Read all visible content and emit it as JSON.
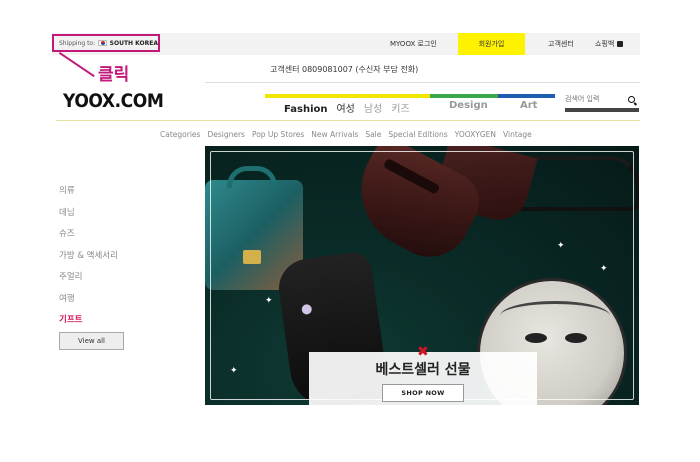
{
  "topbar": {
    "shipping_label": "Shipping to:",
    "country": "SOUTH KOREA",
    "links": {
      "login": "MYOOX 로그인",
      "join": "회원가입",
      "support": "고객센터",
      "cart": "쇼핑백"
    }
  },
  "annotation": {
    "text": "클릭",
    "color": "#c2187a"
  },
  "service_line": "고객센터 0809081007 (수신자 부담 전화)",
  "logo": "YOOX.COM",
  "main_nav": {
    "fashion": "Fashion",
    "women": "여성",
    "men": "남성",
    "kids": "키즈",
    "design": "Design",
    "art": "Art"
  },
  "nav_colors": {
    "fashion": "#f2e600",
    "design": "#3aa84a",
    "art": "#1f5db0"
  },
  "search": {
    "placeholder": "검색어 입력"
  },
  "sub_nav": [
    "Categories",
    "Designers",
    "Pop Up Stores",
    "New Arrivals",
    "Sale",
    "Special Editions",
    "YOOXYGEN",
    "Vintage"
  ],
  "sidebar": {
    "items": [
      "의류",
      "데님",
      "슈즈",
      "가방 & 액세서리",
      "주얼리",
      "여행",
      "기프트"
    ],
    "view_all": "View all"
  },
  "promo": {
    "title": "베스트셀러 선물",
    "button": "SHOP NOW"
  }
}
